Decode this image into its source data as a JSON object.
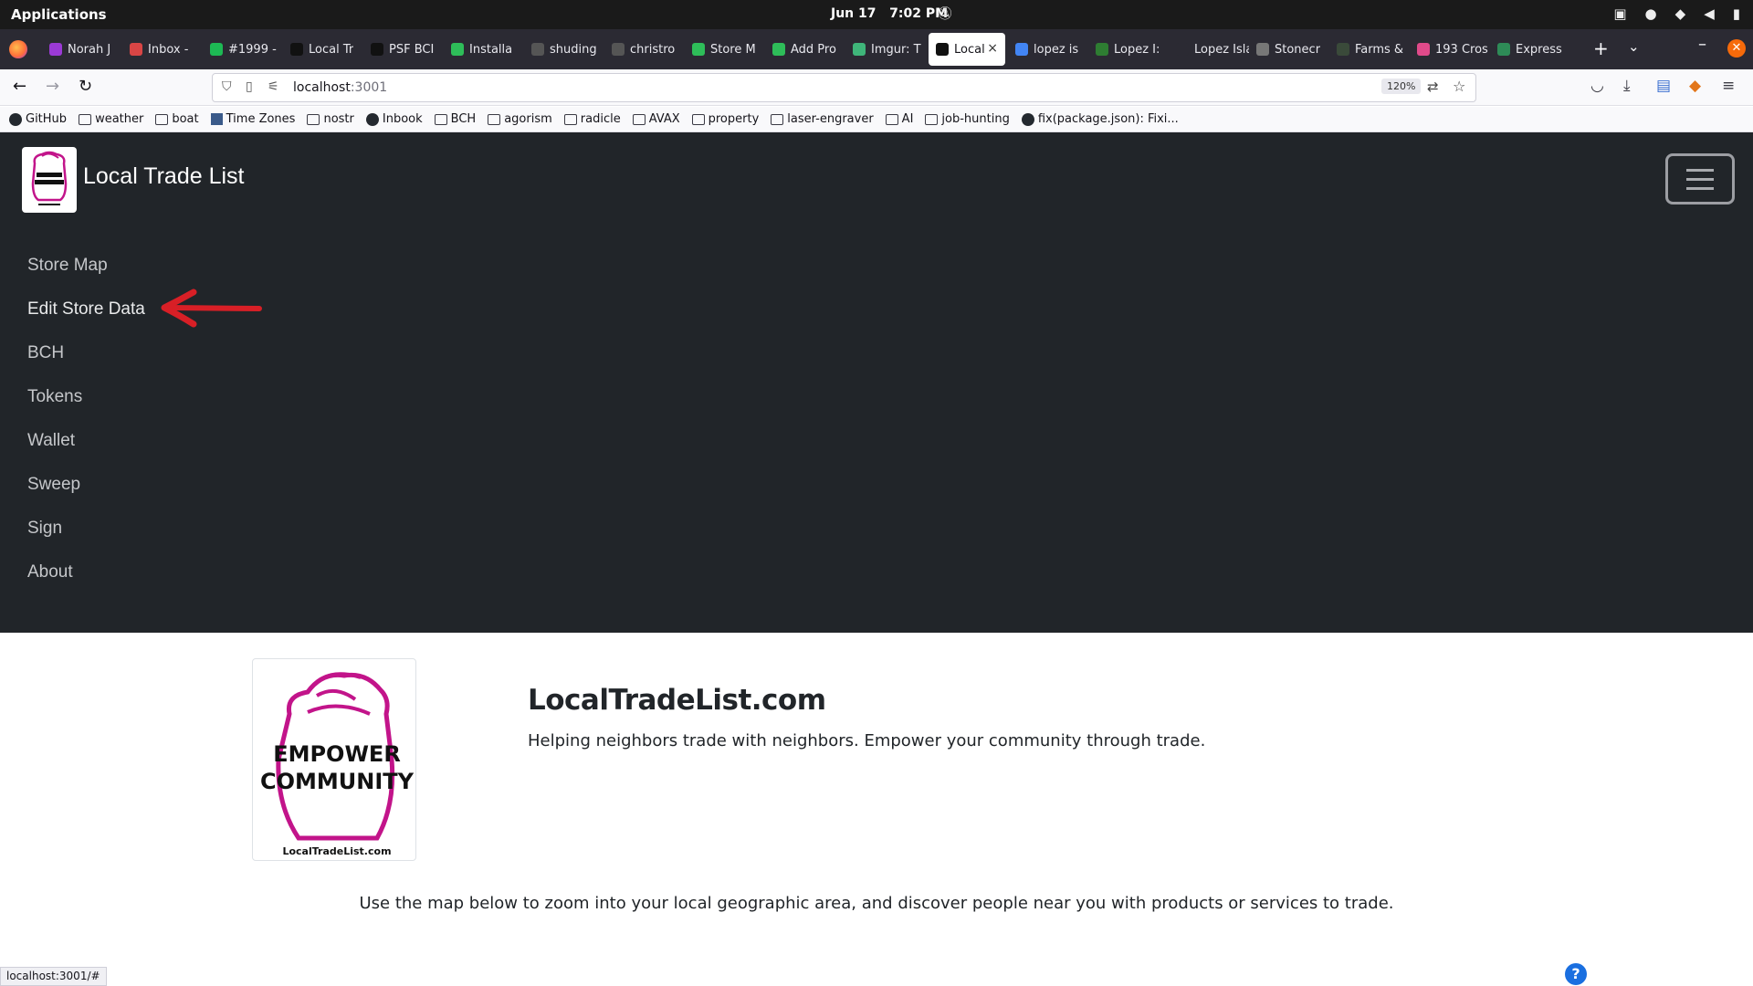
{
  "system_bar": {
    "applications_label": "Applications",
    "date": "Jun 17",
    "time": "7:02 PM",
    "icons": [
      "bell-off-icon",
      "screen-share-icon",
      "user-icon",
      "wifi-icon",
      "volume-icon",
      "battery-icon"
    ]
  },
  "browser": {
    "tabs": [
      {
        "label": "Norah J",
        "favicon_color": "#9b3ad6",
        "active": false
      },
      {
        "label": "Inbox -",
        "favicon_color": "#d94545",
        "active": false
      },
      {
        "label": "#1999 -",
        "favicon_color": "#1db954",
        "active": false
      },
      {
        "label": "Local Tr",
        "favicon_color": "#111111",
        "active": false
      },
      {
        "label": "PSF BCI",
        "favicon_color": "#111111",
        "active": false
      },
      {
        "label": "Installa",
        "favicon_color": "#2ebd59",
        "active": false
      },
      {
        "label": "shuding",
        "favicon_color": "#555555",
        "active": false
      },
      {
        "label": "christro",
        "favicon_color": "#555555",
        "active": false
      },
      {
        "label": "Store M",
        "favicon_color": "#2ebd59",
        "active": false
      },
      {
        "label": "Add Pro",
        "favicon_color": "#2ebd59",
        "active": false
      },
      {
        "label": "Imgur: T",
        "favicon_color": "#3fb57a",
        "active": false
      },
      {
        "label": "Local",
        "favicon_color": "#111111",
        "active": true
      },
      {
        "label": "lopez is",
        "favicon_color": "#4285f4",
        "active": false
      },
      {
        "label": "Lopez I:",
        "favicon_color": "#2e7d32",
        "active": false
      },
      {
        "label": "Lopez Islan",
        "favicon_color": "#2b2a33",
        "active": false
      },
      {
        "label": "Stonecr",
        "favicon_color": "#777777",
        "active": false
      },
      {
        "label": "Farms &",
        "favicon_color": "#3a4a3a",
        "active": false
      },
      {
        "label": "193 Cros",
        "favicon_color": "#e04a8a",
        "active": false
      },
      {
        "label": "Express",
        "favicon_color": "#2e8b57",
        "active": false
      }
    ],
    "new_tab_label": "+",
    "close_tab_glyph": "×",
    "url_host": "localhost",
    "url_port": ":3001",
    "zoom_level": "120%",
    "bookmarks": [
      {
        "label": "GitHub",
        "icon": "github-icon"
      },
      {
        "label": "weather",
        "icon": "folder-icon"
      },
      {
        "label": "boat",
        "icon": "folder-icon"
      },
      {
        "label": "Time Zones",
        "icon": "timezone-icon"
      },
      {
        "label": "nostr",
        "icon": "folder-icon"
      },
      {
        "label": "Inbook",
        "icon": "github-icon"
      },
      {
        "label": "BCH",
        "icon": "folder-icon"
      },
      {
        "label": "agorism",
        "icon": "folder-icon"
      },
      {
        "label": "radicle",
        "icon": "folder-icon"
      },
      {
        "label": "AVAX",
        "icon": "folder-icon"
      },
      {
        "label": "property",
        "icon": "folder-icon"
      },
      {
        "label": "laser-engraver",
        "icon": "folder-icon"
      },
      {
        "label": "AI",
        "icon": "folder-icon"
      },
      {
        "label": "job-hunting",
        "icon": "folder-icon"
      },
      {
        "label": "fix(package.json): Fixi...",
        "icon": "github-icon"
      }
    ],
    "status_url": "localhost:3001/#"
  },
  "site": {
    "brand": "Local Trade List",
    "nav_links": [
      "Store Map",
      "Edit Store Data",
      "BCH",
      "Tokens",
      "Wallet",
      "Sweep",
      "Sign",
      "About"
    ],
    "highlighted_link": "Edit Store Data",
    "logo_text_line1": "EMPOWER",
    "logo_text_line2": "COMMUNITY",
    "logo_caption": "LocalTradeList.com",
    "hero_title": "LocalTradeList.com",
    "hero_tagline": "Helping neighbors trade with neighbors. Empower your community through trade.",
    "map_instruction": "Use the map below to zoom into your local geographic area, and discover people near you with products or services to trade.",
    "help_glyph": "?",
    "colors": {
      "nav_bg": "#212529",
      "logo_magenta": "#c2148a",
      "annotation_red": "#d81f26",
      "help_blue": "#1a6fe0"
    }
  }
}
